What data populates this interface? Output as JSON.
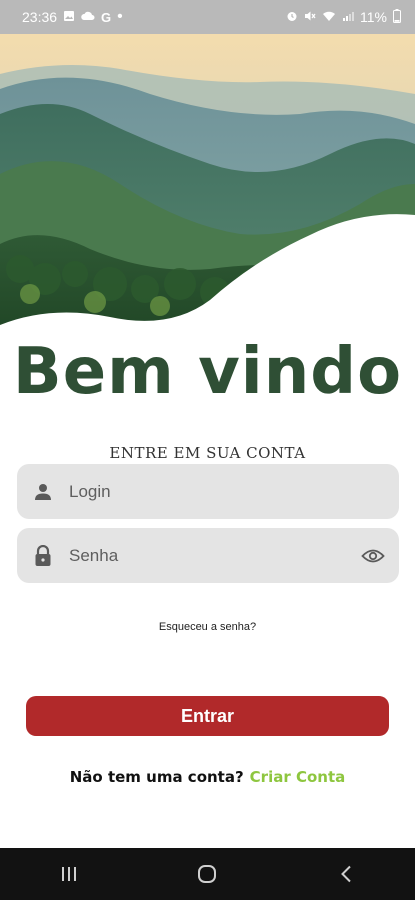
{
  "status_bar": {
    "time": "23:36",
    "battery": "11%",
    "left_icons": [
      "image-icon",
      "cloud-icon",
      "google-icon",
      "dot-icon"
    ],
    "right_icons": [
      "alarm-icon",
      "mute-icon",
      "wifi-icon",
      "signal-icon"
    ]
  },
  "welcome": {
    "title": "Bem vindo",
    "subtitle": "ENTRE EM SUA CONTA"
  },
  "form": {
    "login_placeholder": "Login",
    "password_placeholder": "Senha",
    "login_icon": "person-icon",
    "password_icon": "lock-icon",
    "toggle_icon": "eye-icon",
    "forgot_password": "Esqueceu a senha?",
    "submit_label": "Entrar"
  },
  "signup": {
    "question": "Não tem uma conta?",
    "link": "Criar Conta"
  },
  "navigation": {
    "buttons": [
      "recent-apps-icon",
      "home-icon",
      "back-icon"
    ]
  },
  "colors": {
    "title": "#2f4f35",
    "button": "#b1292a",
    "link": "#8ec63f",
    "field_bg": "#e4e4e4"
  }
}
